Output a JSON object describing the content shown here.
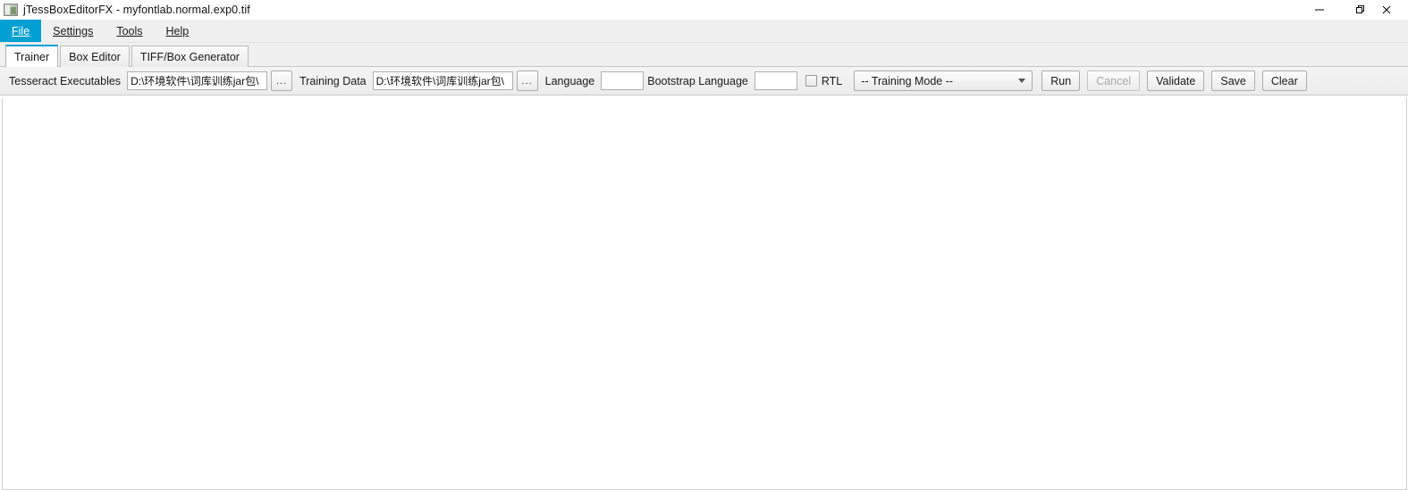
{
  "window": {
    "title": "jTessBoxEditorFX - myfontlab.normal.exp0.tif",
    "icon": "image-file-icon",
    "controls": {
      "minimize": "minimize-button",
      "maximize": "restore-button",
      "close": "close-button"
    }
  },
  "menubar": {
    "items": [
      {
        "label": "File",
        "mnemonic": "F",
        "active": true
      },
      {
        "label": "Settings",
        "mnemonic": "S",
        "active": false
      },
      {
        "label": "Tools",
        "mnemonic": "T",
        "active": false
      },
      {
        "label": "Help",
        "mnemonic": "H",
        "active": false
      }
    ]
  },
  "tabs": [
    {
      "label": "Trainer",
      "selected": true
    },
    {
      "label": "Box Editor",
      "selected": false
    },
    {
      "label": "TIFF/Box Generator",
      "selected": false
    }
  ],
  "toolbar": {
    "tesseract_executables_label": "Tesseract Executables",
    "tesseract_executables_value": "D:\\环境软件\\词库训练jar包\\",
    "browse_label": "...",
    "training_data_label": "Training Data",
    "training_data_value": "D:\\环境软件\\词库训练jar包\\",
    "language_label": "Language",
    "language_value": "",
    "bootstrap_language_label": "Bootstrap Language",
    "bootstrap_language_value": "",
    "rtl_label": "RTL",
    "rtl_checked": false,
    "training_mode_value": "-- Training Mode --",
    "training_mode_options": [
      "-- Training Mode --"
    ],
    "run_label": "Run",
    "cancel_label": "Cancel",
    "cancel_disabled": true,
    "validate_label": "Validate",
    "save_label": "Save",
    "clear_label": "Clear"
  },
  "colors": {
    "accent": "#00a0d2",
    "toolbar_bg": "#ececec",
    "menubar_bg": "#f0f0f0",
    "content_bg": "#ffffff"
  }
}
